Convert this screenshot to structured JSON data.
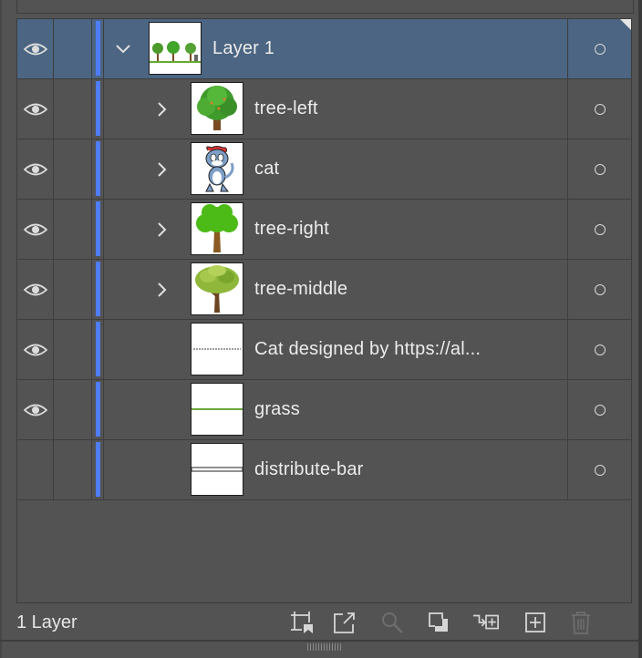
{
  "colors": {
    "panel_bg": "#535353",
    "selected_row": "#4b6582",
    "layer_color_bar": "#4f7cf7"
  },
  "layers": [
    {
      "name": "Layer 1",
      "visible": true,
      "expanded": true,
      "selected": true,
      "thumbnail": "trees-overview"
    },
    {
      "name": "tree-left",
      "visible": true,
      "expandable": true,
      "thumbnail": "tree-round"
    },
    {
      "name": "cat",
      "visible": true,
      "expandable": true,
      "thumbnail": "cartoon-cat"
    },
    {
      "name": "tree-right",
      "visible": true,
      "expandable": true,
      "thumbnail": "tree-simple"
    },
    {
      "name": "tree-middle",
      "visible": true,
      "expandable": true,
      "thumbnail": "tree-leafy"
    },
    {
      "name": "Cat designed by https://al...",
      "visible": true,
      "expandable": false,
      "thumbnail": "text-line"
    },
    {
      "name": "grass",
      "visible": true,
      "expandable": false,
      "thumbnail": "green-line"
    },
    {
      "name": "distribute-bar",
      "visible": false,
      "expandable": false,
      "thumbnail": "bar-outline"
    }
  ],
  "footer": {
    "layer_count": "1 Layer",
    "icons": [
      "collect-for-export-icon",
      "export-icon",
      "locate-object-icon",
      "make-clipping-mask-icon",
      "create-sublayer-icon",
      "create-new-layer-icon",
      "delete-icon"
    ]
  }
}
